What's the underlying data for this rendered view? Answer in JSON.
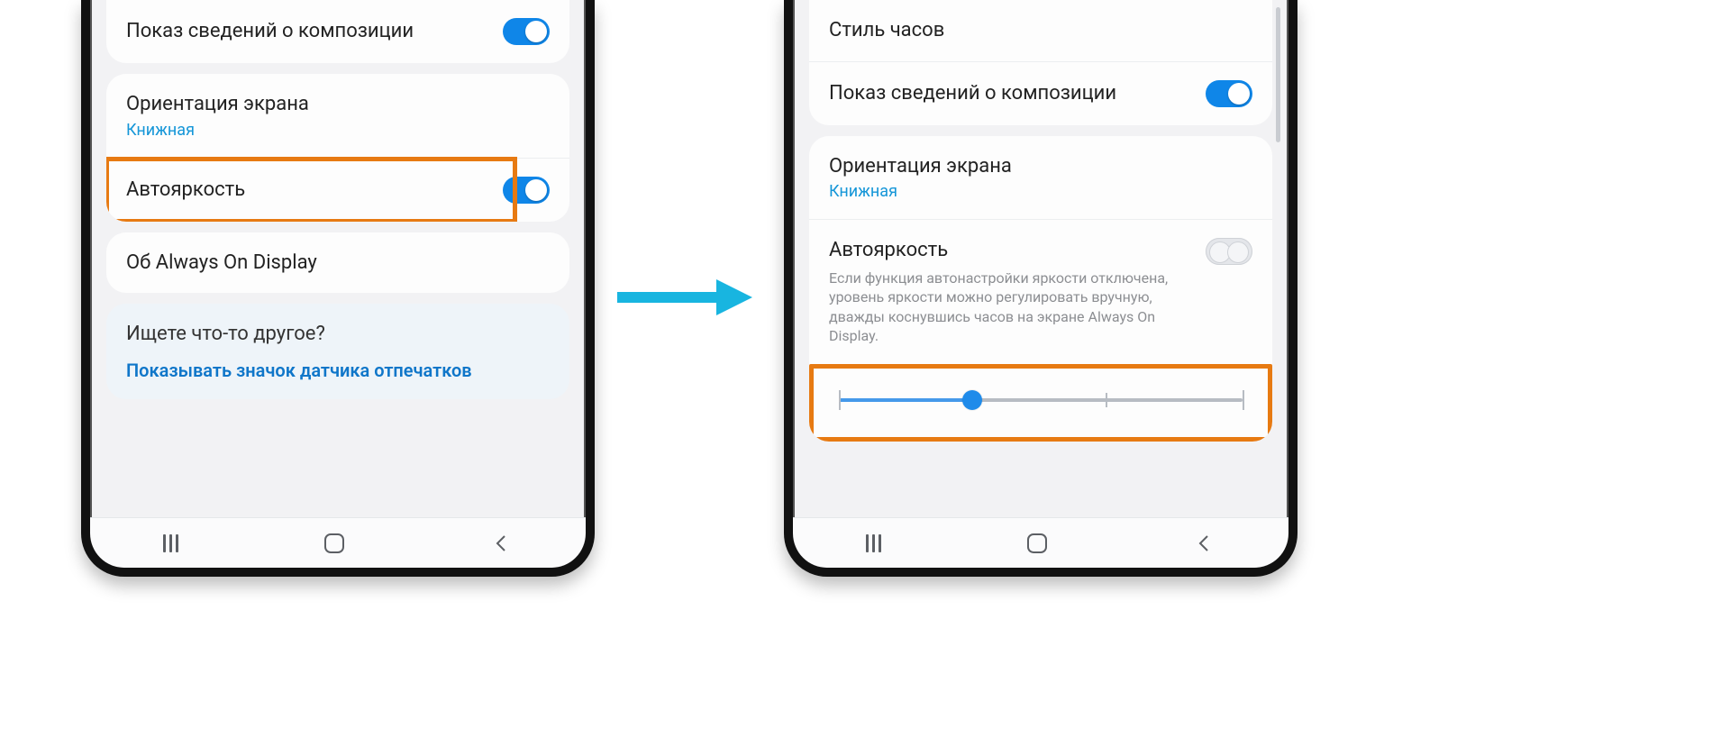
{
  "colors": {
    "accent": "#0f86e8",
    "link": "#0f76c9",
    "highlight": "#e77a12",
    "arrow": "#18b5e0"
  },
  "arrow": {
    "name": "arrow-right-icon"
  },
  "left_phone": {
    "rows": {
      "media_info": {
        "title": "Показ сведений о композиции",
        "toggle": "on"
      },
      "orientation": {
        "title": "Ориентация экрана",
        "sub": "Книжная"
      },
      "auto_bright": {
        "title": "Автояркость",
        "toggle": "on",
        "highlighted": true
      },
      "about_aod": {
        "title": "Об Always On Display"
      }
    },
    "looking": {
      "title": "Ищете что-то другое?",
      "link": "Показывать значок датчика отпечатков"
    }
  },
  "right_phone": {
    "rows": {
      "clock_style": {
        "title": "Стиль часов"
      },
      "media_info": {
        "title": "Показ сведений о композиции",
        "toggle": "on"
      },
      "orientation": {
        "title": "Ориентация экрана",
        "sub": "Книжная"
      },
      "auto_bright": {
        "title": "Автояркость",
        "desc": "Если функция автонастройки яркости отключена, уровень яркости можно регулировать вручную, дважды коснувшись часов на экране Always On Display.",
        "toggle": "off"
      }
    },
    "slider": {
      "value_pct": 33,
      "ticks_pct": [
        0,
        66,
        100
      ],
      "highlighted": true
    }
  },
  "navbar": {
    "recents": "recents-icon",
    "home": "home-icon",
    "back": "back-icon"
  }
}
